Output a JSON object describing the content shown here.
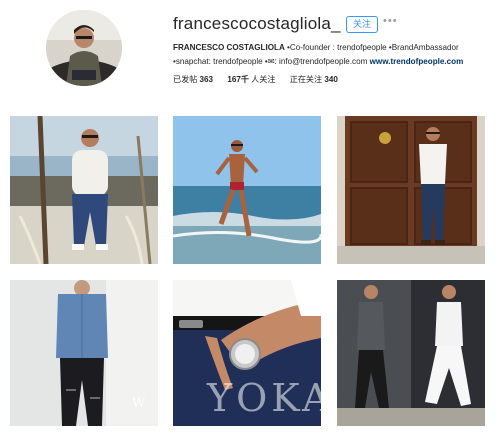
{
  "profile": {
    "username": "francescocostagliola_",
    "follow_label": "关注",
    "more_label": "•••",
    "bio": {
      "name": "FRANCESCO COSTAGLIOLA",
      "part1": " •Co-founder : trendofpeople •BrandAmbassador",
      "part2": "•snapchat: trendofpeople •✉: info@trendofpeople.com ",
      "website": "www.trendofpeople.com"
    },
    "stats": [
      {
        "value": "363",
        "label": "已发帖"
      },
      {
        "value": "167千",
        "label": "人关注"
      },
      {
        "value": "340",
        "label": "正在关注"
      }
    ]
  },
  "posts": [
    {
      "name": "post-man-on-boat"
    },
    {
      "name": "post-man-on-beach"
    },
    {
      "name": "post-man-at-door"
    },
    {
      "name": "post-man-denim-shirt"
    },
    {
      "name": "post-wrist-watch"
    },
    {
      "name": "post-two-outfits"
    }
  ],
  "watermark": "YOKA",
  "colors": {
    "accent": "#3897f0",
    "link": "#003569",
    "text": "#262626"
  }
}
